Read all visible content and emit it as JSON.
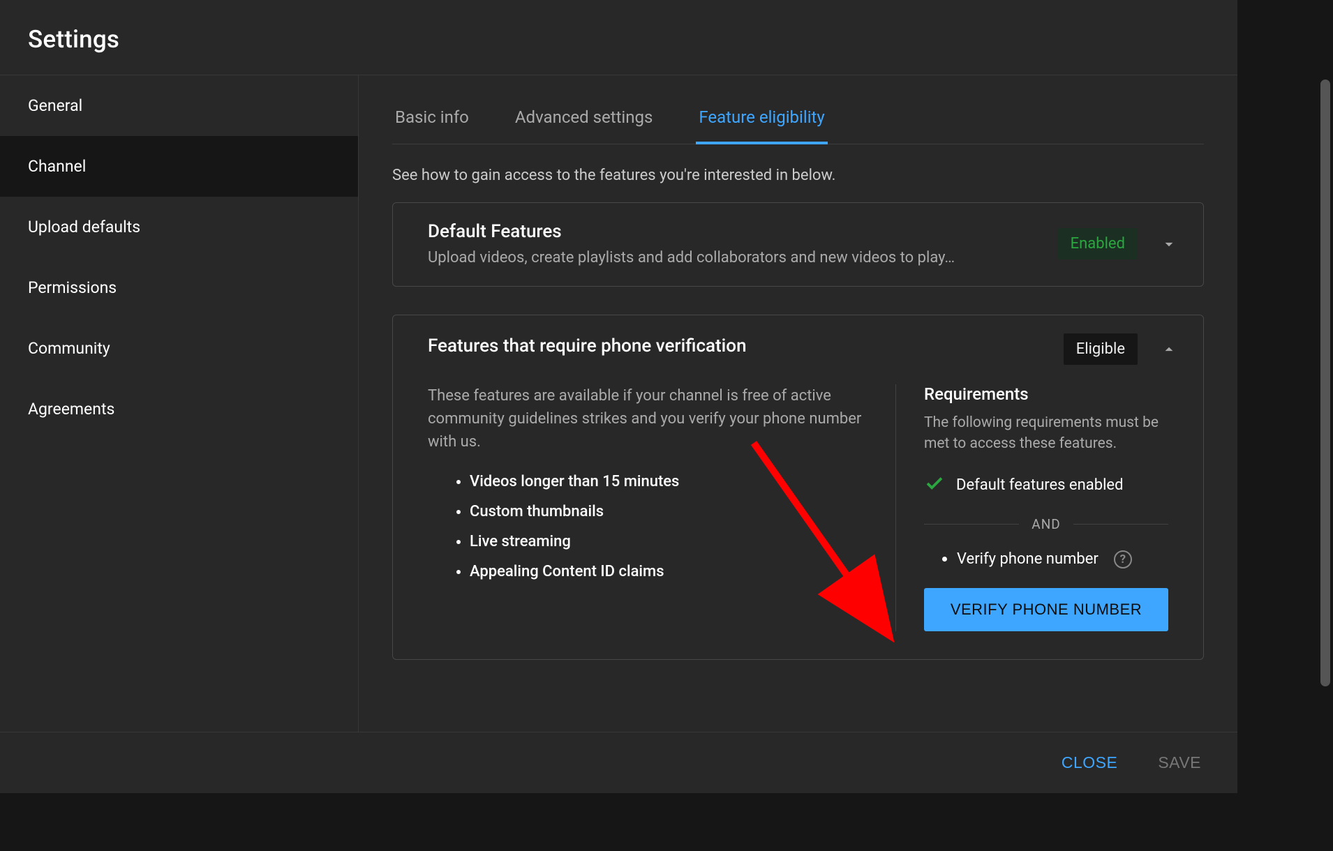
{
  "header": {
    "title": "Settings"
  },
  "sidebar": {
    "items": [
      {
        "label": "General",
        "active": false
      },
      {
        "label": "Channel",
        "active": true
      },
      {
        "label": "Upload defaults",
        "active": false
      },
      {
        "label": "Permissions",
        "active": false
      },
      {
        "label": "Community",
        "active": false
      },
      {
        "label": "Agreements",
        "active": false
      }
    ]
  },
  "tabs": [
    {
      "label": "Basic info",
      "active": false
    },
    {
      "label": "Advanced settings",
      "active": false
    },
    {
      "label": "Feature eligibility",
      "active": true
    }
  ],
  "intro_text": "See how to gain access to the features you're interested in below.",
  "card_default": {
    "title": "Default Features",
    "subtitle": "Upload videos, create playlists and add collaborators and new videos to play…",
    "badge": "Enabled"
  },
  "card_phone": {
    "title": "Features that require phone verification",
    "badge": "Eligible",
    "description": "These features are available if your channel is free of active community guidelines strikes and you verify your phone number with us.",
    "features": [
      "Videos longer than 15 minutes",
      "Custom thumbnails",
      "Live streaming",
      "Appealing Content ID claims"
    ],
    "requirements": {
      "title": "Requirements",
      "description": "The following requirements must be met to access these features.",
      "met_item": "Default features enabled",
      "separator": "AND",
      "pending_item": "Verify phone number",
      "button": "VERIFY PHONE NUMBER"
    }
  },
  "footer": {
    "close": "CLOSE",
    "save": "SAVE"
  }
}
